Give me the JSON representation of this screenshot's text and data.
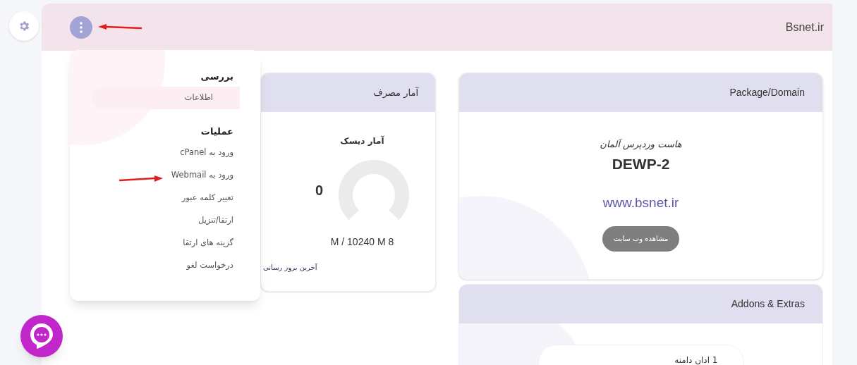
{
  "header": {
    "title": "Bsnet.ir"
  },
  "menu": {
    "sections": [
      {
        "heading": "بررسی",
        "items": [
          {
            "label": "اطلاعات",
            "selected": true
          }
        ]
      },
      {
        "heading": "عملیات",
        "items": [
          {
            "label": "ورود به cPanel",
            "selected": false
          },
          {
            "label": "ورود به Webmail",
            "selected": false
          },
          {
            "label": "تغییر کلمه عبور",
            "selected": false
          },
          {
            "label": "ارتقا/تنزیل",
            "selected": false
          },
          {
            "label": "گزینه های ارتقا",
            "selected": false
          },
          {
            "label": "درخواست لغو",
            "selected": false
          }
        ]
      }
    ]
  },
  "usage_card": {
    "title": "آمار مصرف",
    "disk_title": "آمار دیسک",
    "value": "0",
    "usage": "M / 10240 M 8",
    "last_update": "آخرین بروز رسانی"
  },
  "package_card": {
    "title": "Package/Domain",
    "product": "هاست وردپرس آلمان",
    "plan": "DEWP-2",
    "domain": "www.bsnet.ir",
    "button": "مشاهده وب سایت"
  },
  "addons_card": {
    "title": "Addons & Extras",
    "items": [
      "1 ادان دامنه"
    ]
  }
}
